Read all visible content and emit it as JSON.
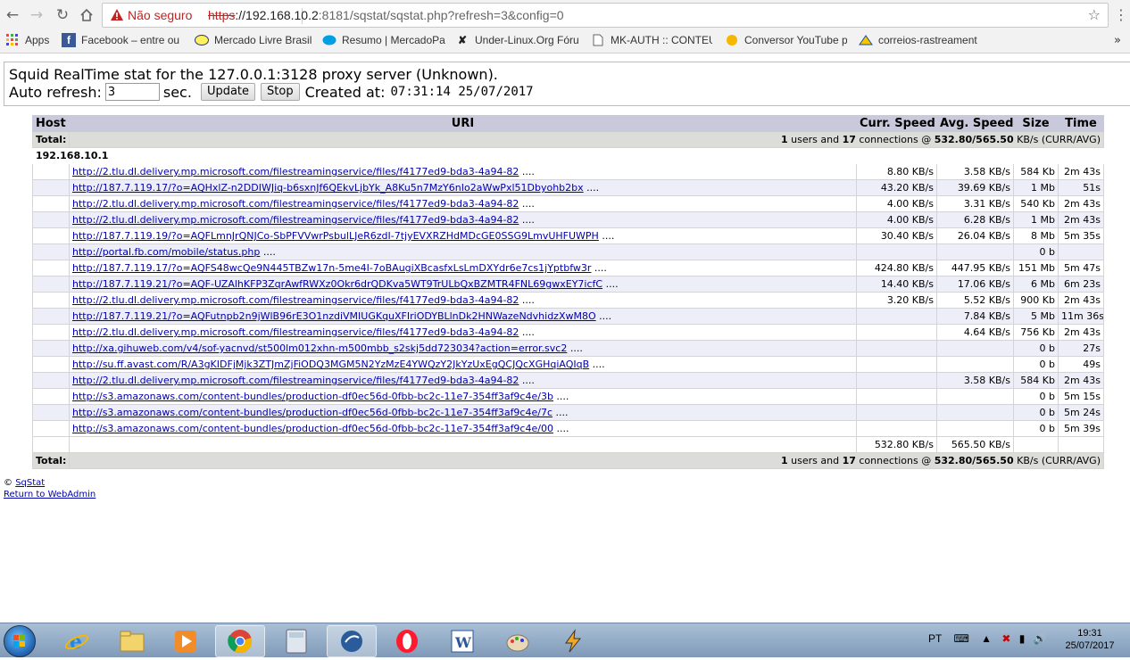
{
  "browser": {
    "security_label": "Não seguro",
    "url_scheme": "https",
    "url_host": "://192.168.10.2",
    "url_rest": ":8181/sqstat/sqstat.php?refresh=3&config=0",
    "bookmarks": [
      {
        "icon": "apps-icon",
        "label": "Apps"
      },
      {
        "icon": "facebook-icon",
        "label": "Facebook – entre ou"
      },
      {
        "icon": "mercadolivre-icon",
        "label": "Mercado Livre Brasil"
      },
      {
        "icon": "mercadopago-icon",
        "label": "Resumo | MercadoPa"
      },
      {
        "icon": "underlinux-icon",
        "label": "Under-Linux.Org Fóru"
      },
      {
        "icon": "page-icon",
        "label": "MK-AUTH :: CONTEU"
      },
      {
        "icon": "converter-icon",
        "label": "Conversor YouTube p"
      },
      {
        "icon": "correios-icon",
        "label": "correios-rastreament"
      }
    ]
  },
  "header": {
    "title": "Squid RealTime stat for the 127.0.0.1:3128 proxy server (Unknown).",
    "auto_refresh_label": "Auto refresh:",
    "refresh_value": "3",
    "sec_label": "sec.",
    "update_button": "Update",
    "stop_button": "Stop",
    "created_label": "Created at:",
    "created_value": "07:31:14 25/07/2017"
  },
  "table": {
    "columns": [
      "Host",
      "URI",
      "Curr. Speed",
      "Avg. Speed",
      "Size",
      "Time"
    ],
    "total_label": "Total:",
    "total_users": "1",
    "total_users_text": " users and ",
    "total_connections": "17",
    "total_conn_text": " connections @ ",
    "total_speed": "532.80/565.50",
    "total_unit": " KB/s (CURR/AVG)",
    "host": "192.168.10.1",
    "rows": [
      {
        "uri": "http://2.tlu.dl.delivery.mp.microsoft.com/filestreamingservice/files/f4177ed9-bda3-4a94-82",
        "curr": "8.80 KB/s",
        "avg": "3.58 KB/s",
        "size": "584 Kb",
        "time": "2m 43s"
      },
      {
        "uri": "http://187.7.119.17/?o=AQHxlZ-n2DDIWJiq-b6sxnJf6QEkvLjbYk_A8Ku5n7MzY6nIo2aWwPxl51Dbyohb2bx",
        "curr": "43.20 KB/s",
        "avg": "39.69 KB/s",
        "size": "1 Mb",
        "time": "51s"
      },
      {
        "uri": "http://2.tlu.dl.delivery.mp.microsoft.com/filestreamingservice/files/f4177ed9-bda3-4a94-82",
        "curr": "4.00 KB/s",
        "avg": "3.31 KB/s",
        "size": "540 Kb",
        "time": "2m 43s"
      },
      {
        "uri": "http://2.tlu.dl.delivery.mp.microsoft.com/filestreamingservice/files/f4177ed9-bda3-4a94-82",
        "curr": "4.00 KB/s",
        "avg": "6.28 KB/s",
        "size": "1 Mb",
        "time": "2m 43s"
      },
      {
        "uri": "http://187.7.119.19/?o=AQFLmnJrQNJCo-SbPFVVwrPsbulLJeR6zdI-7tjyEVXRZHdMDcGE0SSG9LmvUHFUWPH",
        "curr": "30.40 KB/s",
        "avg": "26.04 KB/s",
        "size": "8 Mb",
        "time": "5m 35s"
      },
      {
        "uri": "http://portal.fb.com/mobile/status.php",
        "curr": "",
        "avg": "",
        "size": "0 b",
        "time": ""
      },
      {
        "uri": "http://187.7.119.17/?o=AQFS48wcQe9N445TBZw17n-5me4I-7oBAugiXBcasfxLsLmDXYdr6e7cs1jYptbfw3r",
        "curr": "424.80 KB/s",
        "avg": "447.95 KB/s",
        "size": "151 Mb",
        "time": "5m 47s"
      },
      {
        "uri": "http://187.7.119.21/?o=AQF-UZAlhKFP3ZqrAwfRWXz0Okr6drQDKva5WT9TrULbQxBZMTR4FNL69gwxEY7icfC",
        "curr": "14.40 KB/s",
        "avg": "17.06 KB/s",
        "size": "6 Mb",
        "time": "6m 23s"
      },
      {
        "uri": "http://2.tlu.dl.delivery.mp.microsoft.com/filestreamingservice/files/f4177ed9-bda3-4a94-82",
        "curr": "3.20 KB/s",
        "avg": "5.52 KB/s",
        "size": "900 Kb",
        "time": "2m 43s"
      },
      {
        "uri": "http://187.7.119.21/?o=AQFutnpb2n9jWlB96rE3O1nzdiVMIUGKquXFIriODYBLlnDk2HNWazeNdvhidzXwM8O",
        "curr": "",
        "avg": "7.84 KB/s",
        "size": "5 Mb",
        "time": "11m 36s"
      },
      {
        "uri": "http://2.tlu.dl.delivery.mp.microsoft.com/filestreamingservice/files/f4177ed9-bda3-4a94-82",
        "curr": "",
        "avg": "4.64 KB/s",
        "size": "756 Kb",
        "time": "2m 43s"
      },
      {
        "uri": "http://xa.gihuweb.com/v4/sof-yacnvd/st500lm012xhn-m500mbb_s2skj5dd723034?action=error.svc2",
        "curr": "",
        "avg": "",
        "size": "0 b",
        "time": "27s"
      },
      {
        "uri": "http://su.ff.avast.com/R/A3gKIDFjMjk3ZTJmZjFiODQ3MGM5N2YzMzE4YWQzY2JkYzUxEgQCJQcXGHqiAQIqB",
        "curr": "",
        "avg": "",
        "size": "0 b",
        "time": "49s"
      },
      {
        "uri": "http://2.tlu.dl.delivery.mp.microsoft.com/filestreamingservice/files/f4177ed9-bda3-4a94-82",
        "curr": "",
        "avg": "3.58 KB/s",
        "size": "584 Kb",
        "time": "2m 43s"
      },
      {
        "uri": "http://s3.amazonaws.com/content-bundles/production-df0ec56d-0fbb-bc2c-11e7-354ff3af9c4e/3b",
        "curr": "",
        "avg": "",
        "size": "0 b",
        "time": "5m 15s"
      },
      {
        "uri": "http://s3.amazonaws.com/content-bundles/production-df0ec56d-0fbb-bc2c-11e7-354ff3af9c4e/7c",
        "curr": "",
        "avg": "",
        "size": "0 b",
        "time": "5m 24s"
      },
      {
        "uri": "http://s3.amazonaws.com/content-bundles/production-df0ec56d-0fbb-bc2c-11e7-354ff3af9c4e/00",
        "curr": "",
        "avg": "",
        "size": "0 b",
        "time": "5m 39s"
      }
    ],
    "uri_suffix": " ....",
    "sum_curr": "532.80 KB/s",
    "sum_avg": "565.50 KB/s"
  },
  "footer": {
    "copyright": "© ",
    "sqstat_link": "SqStat",
    "webadmin_link": "Return to WebAdmin"
  },
  "taskbar": {
    "apps": [
      "ie-icon",
      "explorer-icon",
      "media-player-icon",
      "chrome-icon",
      "calculator-icon",
      "winbox-icon",
      "opera-icon",
      "word-icon",
      "paint-icon",
      "winamp-icon"
    ],
    "language": "PT",
    "time": "19:31",
    "date": "25/07/2017"
  },
  "colors": {
    "header_bg": "#c9c9dc",
    "total_bg": "#dcdcd8",
    "alt_row_bg": "#eeeef8",
    "link": "#0000aa",
    "insecure": "#c5221f"
  }
}
